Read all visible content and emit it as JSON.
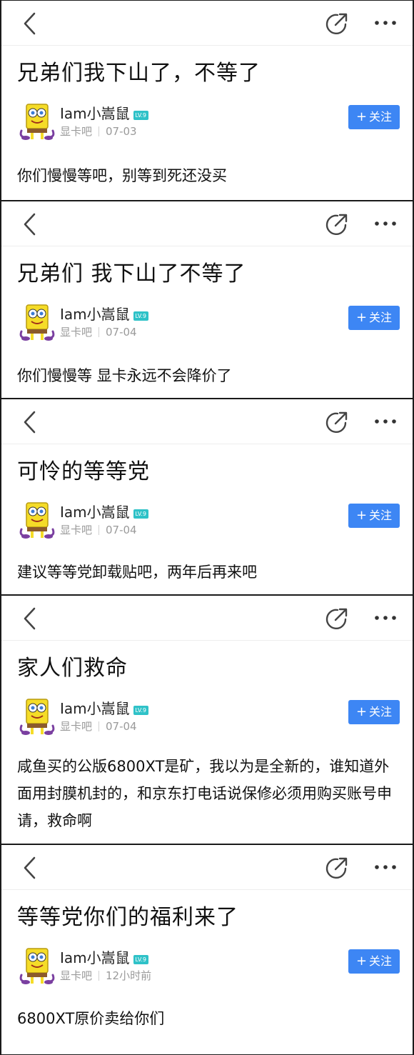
{
  "colors": {
    "follow_button": "#3d86f4",
    "level_badge": "#2fc2c8",
    "separator": "#1a1a1a",
    "meta_text": "#9a9a9a"
  },
  "icons": {
    "back": "back-chevron-icon",
    "share": "share-icon",
    "more": "more-options-icon",
    "avatar": "spongebob-avatar",
    "level": "level-badge-icon"
  },
  "posts": [
    {
      "title": "兄弟们我下山了，不等了",
      "username": "Iam小嵩鼠",
      "level": "LV.9",
      "forum": "显卡吧",
      "time": "07-03",
      "follow_label": "关注",
      "body": "你们慢慢等吧，别等到死还没买"
    },
    {
      "title": "兄弟们 我下山了不等了",
      "username": "Iam小嵩鼠",
      "level": "LV.9",
      "forum": "显卡吧",
      "time": "07-04",
      "follow_label": "关注",
      "body": "你们慢慢等 显卡永远不会降价了"
    },
    {
      "title": "可怜的等等党",
      "username": "Iam小嵩鼠",
      "level": "LV.9",
      "forum": "显卡吧",
      "time": "07-04",
      "follow_label": "关注",
      "body": "建议等等党卸载贴吧，两年后再来吧"
    },
    {
      "title": "家人们救命",
      "username": "Iam小嵩鼠",
      "level": "LV.9",
      "forum": "显卡吧",
      "time": "07-04",
      "follow_label": "关注",
      "body": "咸鱼买的公版6800XT是矿，我以为是全新的，谁知道外面用封膜机封的，和京东打电话说保修必须用购买账号申请，救命啊"
    },
    {
      "title": "等等党你们的福利来了",
      "username": "Iam小嵩鼠",
      "level": "LV.9",
      "forum": "显卡吧",
      "time": "12小时前",
      "follow_label": "关注",
      "body": "6800XT原价卖给你们"
    }
  ]
}
